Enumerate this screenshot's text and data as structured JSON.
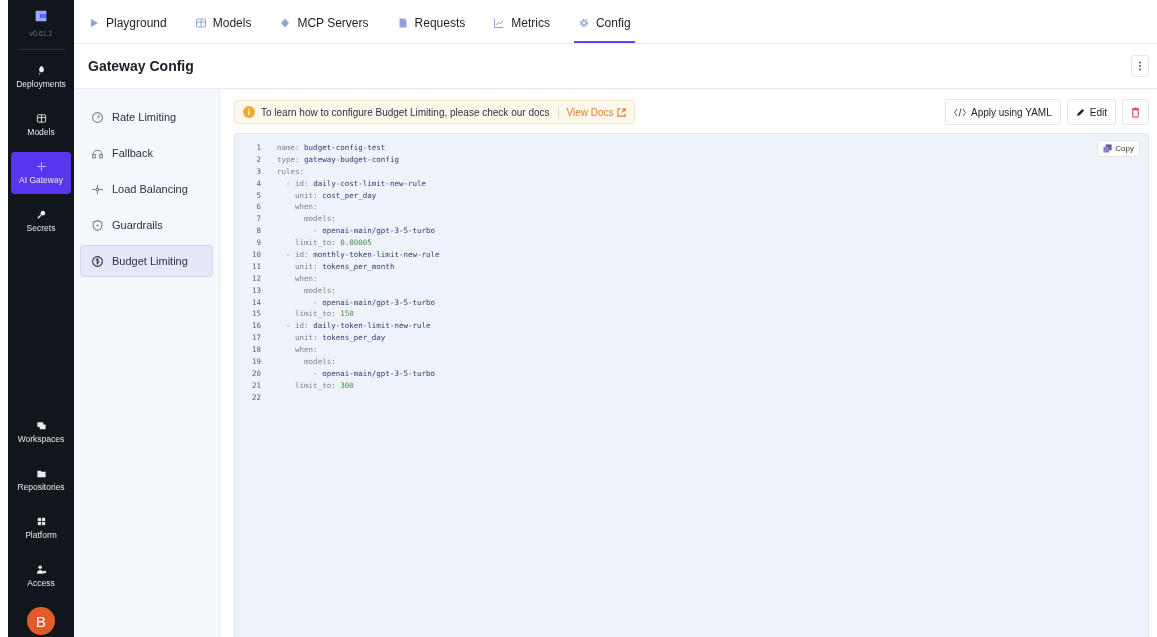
{
  "app_nav": {
    "version": "v0.61.2",
    "top_items": [
      {
        "label": "Deployments",
        "selected": false
      },
      {
        "label": "Models",
        "selected": false
      },
      {
        "label": "AI Gateway",
        "selected": true
      },
      {
        "label": "Secrets",
        "selected": false
      }
    ],
    "bottom_items": [
      {
        "label": "Workspaces",
        "selected": false
      },
      {
        "label": "Repositories",
        "selected": false
      },
      {
        "label": "Platform",
        "selected": false
      },
      {
        "label": "Access",
        "selected": false
      }
    ],
    "avatar": "B"
  },
  "tabs": [
    {
      "label": "Playground",
      "selected": false
    },
    {
      "label": "Models",
      "selected": false
    },
    {
      "label": "MCP Servers",
      "selected": false
    },
    {
      "label": "Requests",
      "selected": false
    },
    {
      "label": "Metrics",
      "selected": false
    },
    {
      "label": "Config",
      "selected": true
    }
  ],
  "page_title": "Gateway Config",
  "sidebar": {
    "items": [
      {
        "label": "Rate Limiting",
        "selected": false
      },
      {
        "label": "Fallback",
        "selected": false
      },
      {
        "label": "Load Balancing",
        "selected": false
      },
      {
        "label": "Guardrails",
        "selected": false
      },
      {
        "label": "Budget Limiting",
        "selected": true
      }
    ]
  },
  "banner": {
    "text": "To learn how to configure Budget Limiting, please check our docs",
    "link": "View Docs"
  },
  "actions": {
    "apply": "Apply using YAML",
    "edit": "Edit"
  },
  "editor": {
    "copy": "Copy",
    "lines": [
      {
        "number": "1",
        "key": "name:",
        "value": "budget-config-test",
        "kind": "string"
      },
      {
        "number": "2",
        "key": "type:",
        "value": "gateway-budget-config",
        "kind": "string"
      },
      {
        "number": "3",
        "key": "rules:"
      },
      {
        "number": "4",
        "key": "  - id:",
        "value": "daily-cost-limit-new-rule",
        "kind": "string"
      },
      {
        "number": "5",
        "key": "    unit:",
        "value": "cost_per_day",
        "kind": "string"
      },
      {
        "number": "6",
        "key": "    when:"
      },
      {
        "number": "7",
        "key": "      models:"
      },
      {
        "number": "8",
        "key": "        -",
        "value": "openai-main/gpt-3-5-turbo",
        "kind": "string"
      },
      {
        "number": "9",
        "key": "    limit_to:",
        "value": "0.00005",
        "kind": "number"
      },
      {
        "number": "10",
        "key": "  - id:",
        "value": "monthly-token-limit-new-rule",
        "kind": "string"
      },
      {
        "number": "11",
        "key": "    unit:",
        "value": "tokens_per_month",
        "kind": "string"
      },
      {
        "number": "12",
        "key": "    when:"
      },
      {
        "number": "13",
        "key": "      models:"
      },
      {
        "number": "14",
        "key": "        -",
        "value": "openai-main/gpt-3-5-turbo",
        "kind": "string"
      },
      {
        "number": "15",
        "key": "    limit_to:",
        "value": "150",
        "kind": "number"
      },
      {
        "number": "16",
        "key": "  - id:",
        "value": "daily-token-limit-new-rule",
        "kind": "string"
      },
      {
        "number": "17",
        "key": "    unit:",
        "value": "tokens_per_day",
        "kind": "string"
      },
      {
        "number": "18",
        "key": "    when:"
      },
      {
        "number": "19",
        "key": "      models:"
      },
      {
        "number": "20",
        "key": "        -",
        "value": "openai-main/gpt-3-5-turbo",
        "kind": "string"
      },
      {
        "number": "21",
        "key": "    limit_to:",
        "value": "300",
        "kind": "number"
      },
      {
        "number": "22"
      }
    ]
  }
}
